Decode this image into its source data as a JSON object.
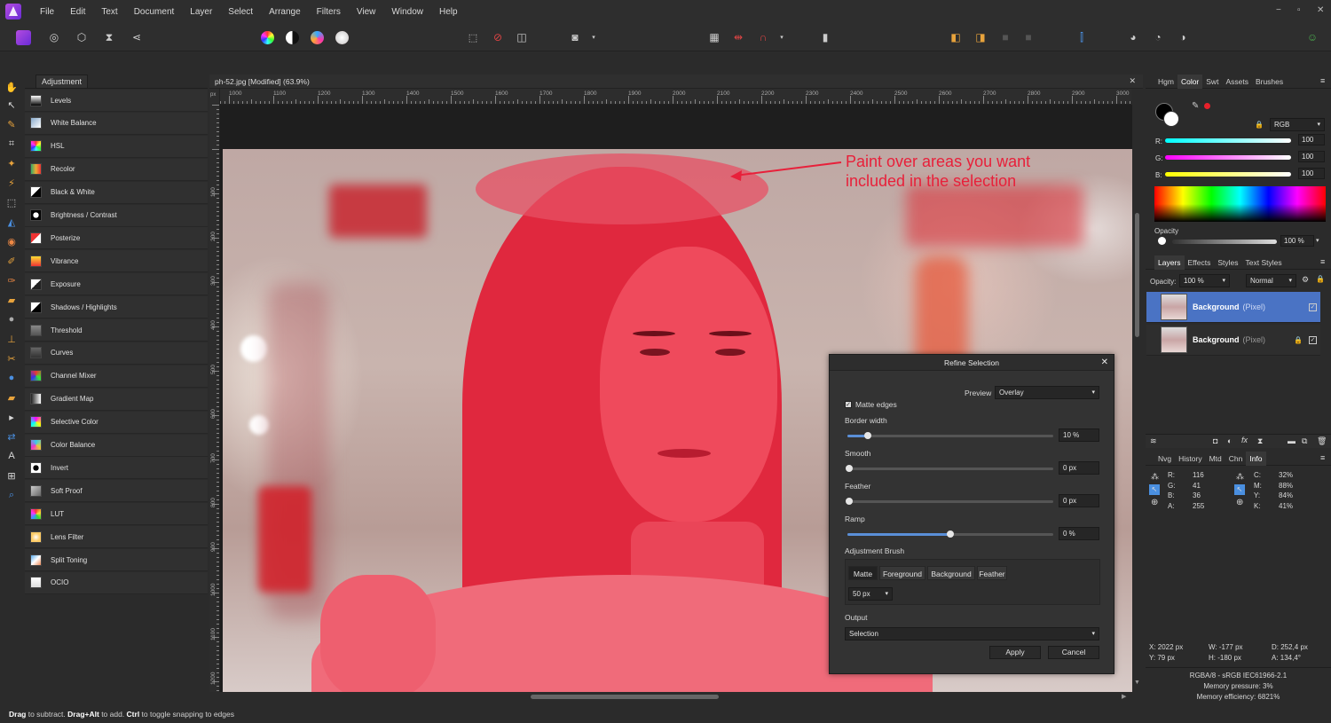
{
  "menu": [
    "File",
    "Edit",
    "Text",
    "Document",
    "Layer",
    "Select",
    "Arrange",
    "Filters",
    "View",
    "Window",
    "Help"
  ],
  "window_controls": {
    "minimize": "−",
    "restore": "▫",
    "close": "✕"
  },
  "adjustment_panel": {
    "tab": "Adjustment",
    "items": [
      {
        "label": "Levels",
        "icon": "levels-icon"
      },
      {
        "label": "White Balance",
        "icon": "white-balance-icon"
      },
      {
        "label": "HSL",
        "icon": "hsl-icon"
      },
      {
        "label": "Recolor",
        "icon": "recolor-icon"
      },
      {
        "label": "Black & White",
        "icon": "black-white-icon"
      },
      {
        "label": "Brightness / Contrast",
        "icon": "brightness-contrast-icon"
      },
      {
        "label": "Posterize",
        "icon": "posterize-icon"
      },
      {
        "label": "Vibrance",
        "icon": "vibrance-icon"
      },
      {
        "label": "Exposure",
        "icon": "exposure-icon"
      },
      {
        "label": "Shadows / Highlights",
        "icon": "shadows-highlights-icon"
      },
      {
        "label": "Threshold",
        "icon": "threshold-icon"
      },
      {
        "label": "Curves",
        "icon": "curves-icon"
      },
      {
        "label": "Channel Mixer",
        "icon": "channel-mixer-icon"
      },
      {
        "label": "Gradient Map",
        "icon": "gradient-map-icon"
      },
      {
        "label": "Selective Color",
        "icon": "selective-color-icon"
      },
      {
        "label": "Color Balance",
        "icon": "color-balance-icon"
      },
      {
        "label": "Invert",
        "icon": "invert-icon"
      },
      {
        "label": "Soft Proof",
        "icon": "soft-proof-icon"
      },
      {
        "label": "LUT",
        "icon": "lut-icon"
      },
      {
        "label": "Lens Filter",
        "icon": "lens-filter-icon"
      },
      {
        "label": "Split Toning",
        "icon": "split-toning-icon"
      },
      {
        "label": "OCIO",
        "icon": "ocio-icon"
      }
    ]
  },
  "document": {
    "title": "ph-52.jpg [Modified] (63.9%)",
    "close": "✕",
    "ruler_unit": "px",
    "ruler_h": [
      "1000",
      "1100",
      "1200",
      "1300",
      "1400",
      "1500",
      "1600",
      "1700",
      "1800",
      "1900",
      "2000",
      "2100",
      "2200",
      "2300",
      "2400",
      "2500",
      "2600",
      "2700",
      "2800",
      "2900",
      "3000"
    ],
    "ruler_v": [
      "100",
      "200",
      "300",
      "400",
      "500",
      "600",
      "700",
      "800",
      "900",
      "1000",
      "1100",
      "1200"
    ]
  },
  "annotation": {
    "line1": "Paint over areas you want",
    "line2": "included in the selection",
    "color": "#e8203a"
  },
  "refine": {
    "title": "Refine Selection",
    "preview_label": "Preview",
    "preview_value": "Overlay",
    "matte_edges": "Matte edges",
    "border_width_label": "Border width",
    "border_width_value": "10 %",
    "border_width_level": 0.1,
    "smooth_label": "Smooth",
    "smooth_value": "0 px",
    "feather_label": "Feather",
    "feather_value": "0 px",
    "ramp_label": "Ramp",
    "ramp_value": "0 %",
    "ramp_level": 0.5,
    "brush_label": "Adjustment Brush",
    "brush_modes": [
      "Matte",
      "Foreground",
      "Background",
      "Feather"
    ],
    "brush_size": "50 px",
    "output_label": "Output",
    "output_value": "Selection",
    "apply": "Apply",
    "cancel": "Cancel"
  },
  "right_panel": {
    "top_tabs": [
      "Hgm",
      "Color",
      "Swt",
      "Assets",
      "Brushes"
    ],
    "active_top_tab": "Color",
    "color_model": "RGB",
    "r_label": "R:",
    "r_value": "100",
    "g_label": "G:",
    "g_value": "100",
    "b_label": "B:",
    "b_value": "100",
    "opacity_label": "Opacity",
    "opacity_value": "100 %",
    "layer_tabs": [
      "Layers",
      "Effects",
      "Styles",
      "Text Styles"
    ],
    "active_layer_tab": "Layers",
    "layer_opacity_label": "Opacity:",
    "layer_opacity_value": "100 %",
    "blend_mode": "Normal",
    "layers": [
      {
        "name": "Background",
        "type": "(Pixel)",
        "selected": true
      },
      {
        "name": "Background",
        "type": "(Pixel)",
        "selected": false
      }
    ],
    "info_tabs": [
      "Nvg",
      "History",
      "Mtd",
      "Chn",
      "Info"
    ],
    "active_info_tab": "Info",
    "rgba": [
      {
        "k": "R:",
        "v": "116"
      },
      {
        "k": "G:",
        "v": "41"
      },
      {
        "k": "B:",
        "v": "36"
      },
      {
        "k": "A:",
        "v": "255"
      }
    ],
    "cmyk": [
      {
        "k": "C:",
        "v": "32%"
      },
      {
        "k": "M:",
        "v": "88%"
      },
      {
        "k": "Y:",
        "v": "84%"
      },
      {
        "k": "K:",
        "v": "41%"
      }
    ],
    "x_pos": "X: 2022 px",
    "y_pos": "Y: 79 px",
    "w_size": "W: -177 px",
    "h_size": "H: -180 px",
    "d_val": "D: 252,4 px",
    "a_val": "A: 134,4°",
    "color_profile": "RGBA/8 - sRGB IEC61966-2.1",
    "memory_pressure": "Memory pressure: 3%",
    "memory_efficiency": "Memory efficiency: 6821%"
  },
  "status": {
    "k1": "Drag",
    "t1": " to subtract. ",
    "k2": "Drag+Alt",
    "t2": " to add. ",
    "k3": "Ctrl",
    "t3": " to toggle snapping to edges"
  }
}
